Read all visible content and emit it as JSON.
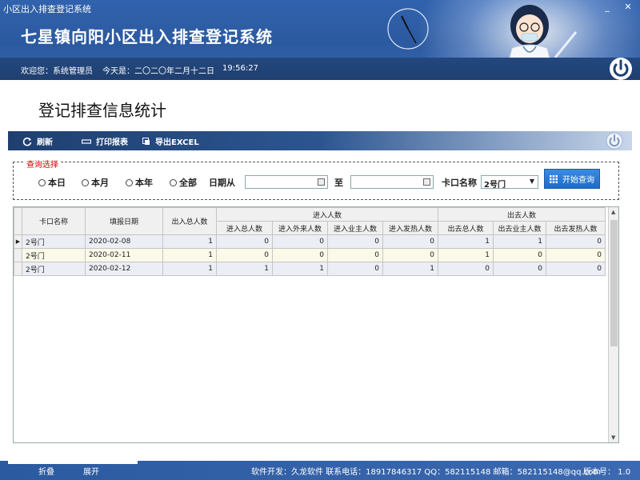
{
  "window": {
    "title": "小区出入排查登记系统",
    "minimize": "_",
    "close": "✕"
  },
  "header": {
    "app_title": "七星镇向阳小区出入排查登记系统",
    "welcome": "欢迎您：系统管理员",
    "today": "今天是：二〇二〇年二月十二日",
    "time": "19:56:27"
  },
  "page": {
    "title": "登记排查信息统计"
  },
  "toolbar": {
    "refresh": "刷新",
    "print": "打印报表",
    "export": "导出EXCEL"
  },
  "query": {
    "legend": "查询选择",
    "radios": [
      "本日",
      "本月",
      "本年",
      "全部"
    ],
    "date_from_label": "日期从",
    "date_to_label": "至",
    "date_from_value": "",
    "date_to_value": "",
    "gate_label": "卡口名称",
    "gate_value": "2号门",
    "search_button": "开始查询"
  },
  "grid": {
    "headers": {
      "gate": "卡口名称",
      "date": "填报日期",
      "total": "出入总人数",
      "in_group": "进入人数",
      "out_group": "出去人数",
      "in_total": "进入总人数",
      "in_visitor": "进入外来人数",
      "in_owner": "进入业主人数",
      "in_fever": "进入发热人数",
      "out_total": "出去总人数",
      "out_owner": "出去业主人数",
      "out_fever": "出去发热人数"
    },
    "rows": [
      {
        "gate": "2号门",
        "date": "2020-02-08",
        "total": "1",
        "in_total": "0",
        "in_visitor": "0",
        "in_owner": "0",
        "in_fever": "0",
        "out_total": "1",
        "out_owner": "1",
        "out_fever": "0"
      },
      {
        "gate": "2号门",
        "date": "2020-02-11",
        "total": "1",
        "in_total": "0",
        "in_visitor": "0",
        "in_owner": "0",
        "in_fever": "0",
        "out_total": "1",
        "out_owner": "0",
        "out_fever": "0"
      },
      {
        "gate": "2号门",
        "date": "2020-02-12",
        "total": "1",
        "in_total": "1",
        "in_visitor": "1",
        "in_owner": "0",
        "in_fever": "1",
        "out_total": "0",
        "out_owner": "0",
        "out_fever": "0"
      }
    ]
  },
  "statusbar": {
    "collapse": "折叠",
    "expand": "展开",
    "info": "软件开发：久龙软件   联系电话：18917846317   QQ：582115148  邮箱：582115148@qq.com",
    "version": "版本号： 1.0"
  },
  "colors": {
    "header_blue": "#2c5aa0",
    "accent_red": "#cc0000",
    "button_blue": "#1f6cc8"
  }
}
